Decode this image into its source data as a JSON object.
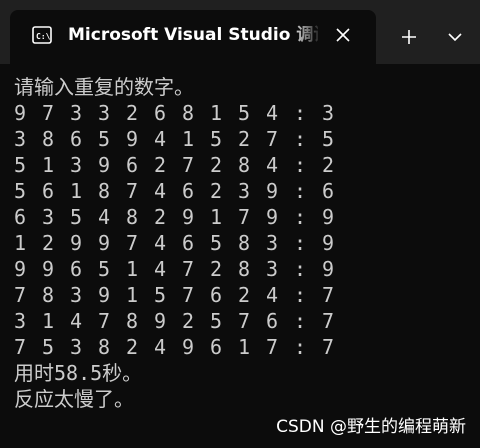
{
  "tab": {
    "icon": "console-icon",
    "title": "Microsoft Visual Studio 调试控制台"
  },
  "titlebar": {
    "close_icon": "close-icon",
    "new_tab_icon": "plus-icon",
    "dropdown_icon": "chevron-down-icon"
  },
  "console": {
    "prompt": "请输入重复的数字。",
    "rows": [
      {
        "digits": [
          "9",
          "7",
          "3",
          "3",
          "2",
          "6",
          "8",
          "1",
          "5",
          "4"
        ],
        "sep": ":",
        "answer": "3"
      },
      {
        "digits": [
          "3",
          "8",
          "6",
          "5",
          "9",
          "4",
          "1",
          "5",
          "2",
          "7"
        ],
        "sep": ":",
        "answer": "5"
      },
      {
        "digits": [
          "5",
          "1",
          "3",
          "9",
          "6",
          "2",
          "7",
          "2",
          "8",
          "4"
        ],
        "sep": ":",
        "answer": "2"
      },
      {
        "digits": [
          "5",
          "6",
          "1",
          "8",
          "7",
          "4",
          "6",
          "2",
          "3",
          "9"
        ],
        "sep": ":",
        "answer": "6"
      },
      {
        "digits": [
          "6",
          "3",
          "5",
          "4",
          "8",
          "2",
          "9",
          "1",
          "7",
          "9"
        ],
        "sep": ":",
        "answer": "9"
      },
      {
        "digits": [
          "1",
          "2",
          "9",
          "9",
          "7",
          "4",
          "6",
          "5",
          "8",
          "3"
        ],
        "sep": ":",
        "answer": "9"
      },
      {
        "digits": [
          "9",
          "9",
          "6",
          "5",
          "1",
          "4",
          "7",
          "2",
          "8",
          "3"
        ],
        "sep": ":",
        "answer": "9"
      },
      {
        "digits": [
          "7",
          "8",
          "3",
          "9",
          "1",
          "5",
          "7",
          "6",
          "2",
          "4"
        ],
        "sep": ":",
        "answer": "7"
      },
      {
        "digits": [
          "3",
          "1",
          "4",
          "7",
          "8",
          "9",
          "2",
          "5",
          "7",
          "6"
        ],
        "sep": ":",
        "answer": "7"
      },
      {
        "digits": [
          "7",
          "5",
          "3",
          "8",
          "2",
          "4",
          "9",
          "6",
          "1",
          "7"
        ],
        "sep": ":",
        "answer": "7"
      }
    ],
    "time_line": "用时58.5秒。",
    "result_line": "反应太慢了。"
  },
  "watermark": "CSDN @野生的编程萌新"
}
